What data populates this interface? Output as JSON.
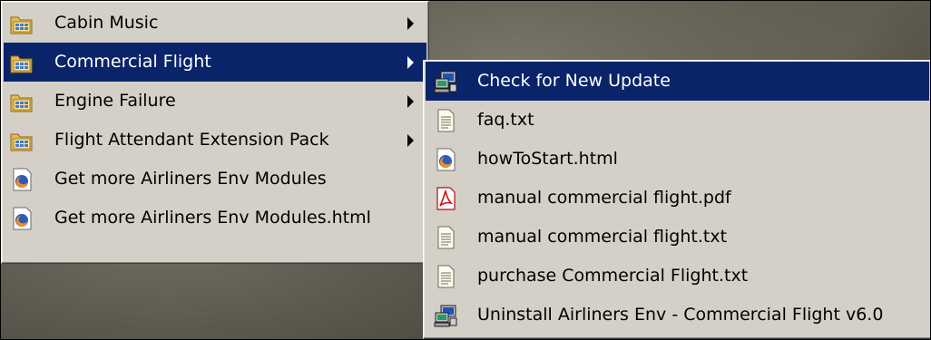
{
  "main_menu": {
    "items": [
      {
        "label": "Cabin Music",
        "icon": "program-group-folder-icon",
        "has_submenu": true
      },
      {
        "label": "Commercial Flight",
        "icon": "program-group-folder-icon",
        "has_submenu": true,
        "selected": true
      },
      {
        "label": "Engine Failure",
        "icon": "program-group-folder-icon",
        "has_submenu": true
      },
      {
        "label": "Flight Attendant Extension Pack",
        "icon": "program-group-folder-icon",
        "has_submenu": true
      },
      {
        "label": "Get more Airliners Env Modules",
        "icon": "firefox-document-icon",
        "has_submenu": false
      },
      {
        "label": "Get more Airliners Env Modules.html",
        "icon": "firefox-document-icon",
        "has_submenu": false
      }
    ]
  },
  "sub_menu": {
    "items": [
      {
        "label": "Check for New Update",
        "icon": "computer-program-icon",
        "selected": true
      },
      {
        "label": "faq.txt",
        "icon": "text-file-icon"
      },
      {
        "label": "howToStart.html",
        "icon": "firefox-document-icon"
      },
      {
        "label": "manual commercial flight.pdf",
        "icon": "pdf-file-icon"
      },
      {
        "label": "manual commercial flight.txt",
        "icon": "text-file-icon"
      },
      {
        "label": "purchase Commercial Flight.txt",
        "icon": "text-file-icon"
      },
      {
        "label": "Uninstall Airliners Env - Commercial Flight v6.0",
        "icon": "computer-program-icon"
      }
    ]
  },
  "colors": {
    "menu_background": "#d4d0c8",
    "selection_background": "#0a246a",
    "selection_text": "#ffffff"
  }
}
